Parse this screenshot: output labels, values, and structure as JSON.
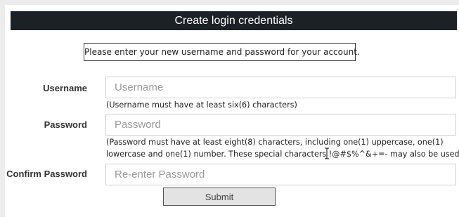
{
  "header": {
    "title": "Create login credentials"
  },
  "notice": "Please enter your new username and password for your account.",
  "form": {
    "username": {
      "label": "Username",
      "placeholder": "Username",
      "hint": "(Username must have at least six(6) characters)"
    },
    "password": {
      "label": "Password",
      "placeholder": "Password",
      "hint_line1": "(Password must have at least eight(8) characters, including one(1) uppercase, one(1)",
      "hint_line2": "lowercase and one(1) number. These special characters !@#$%^&+=- may also be used.)"
    },
    "confirm_password": {
      "label": "Confirm Password",
      "placeholder": "Re-enter Password"
    },
    "submit_label": "Submit"
  },
  "icons": {
    "cursor": "text-cursor-icon"
  }
}
